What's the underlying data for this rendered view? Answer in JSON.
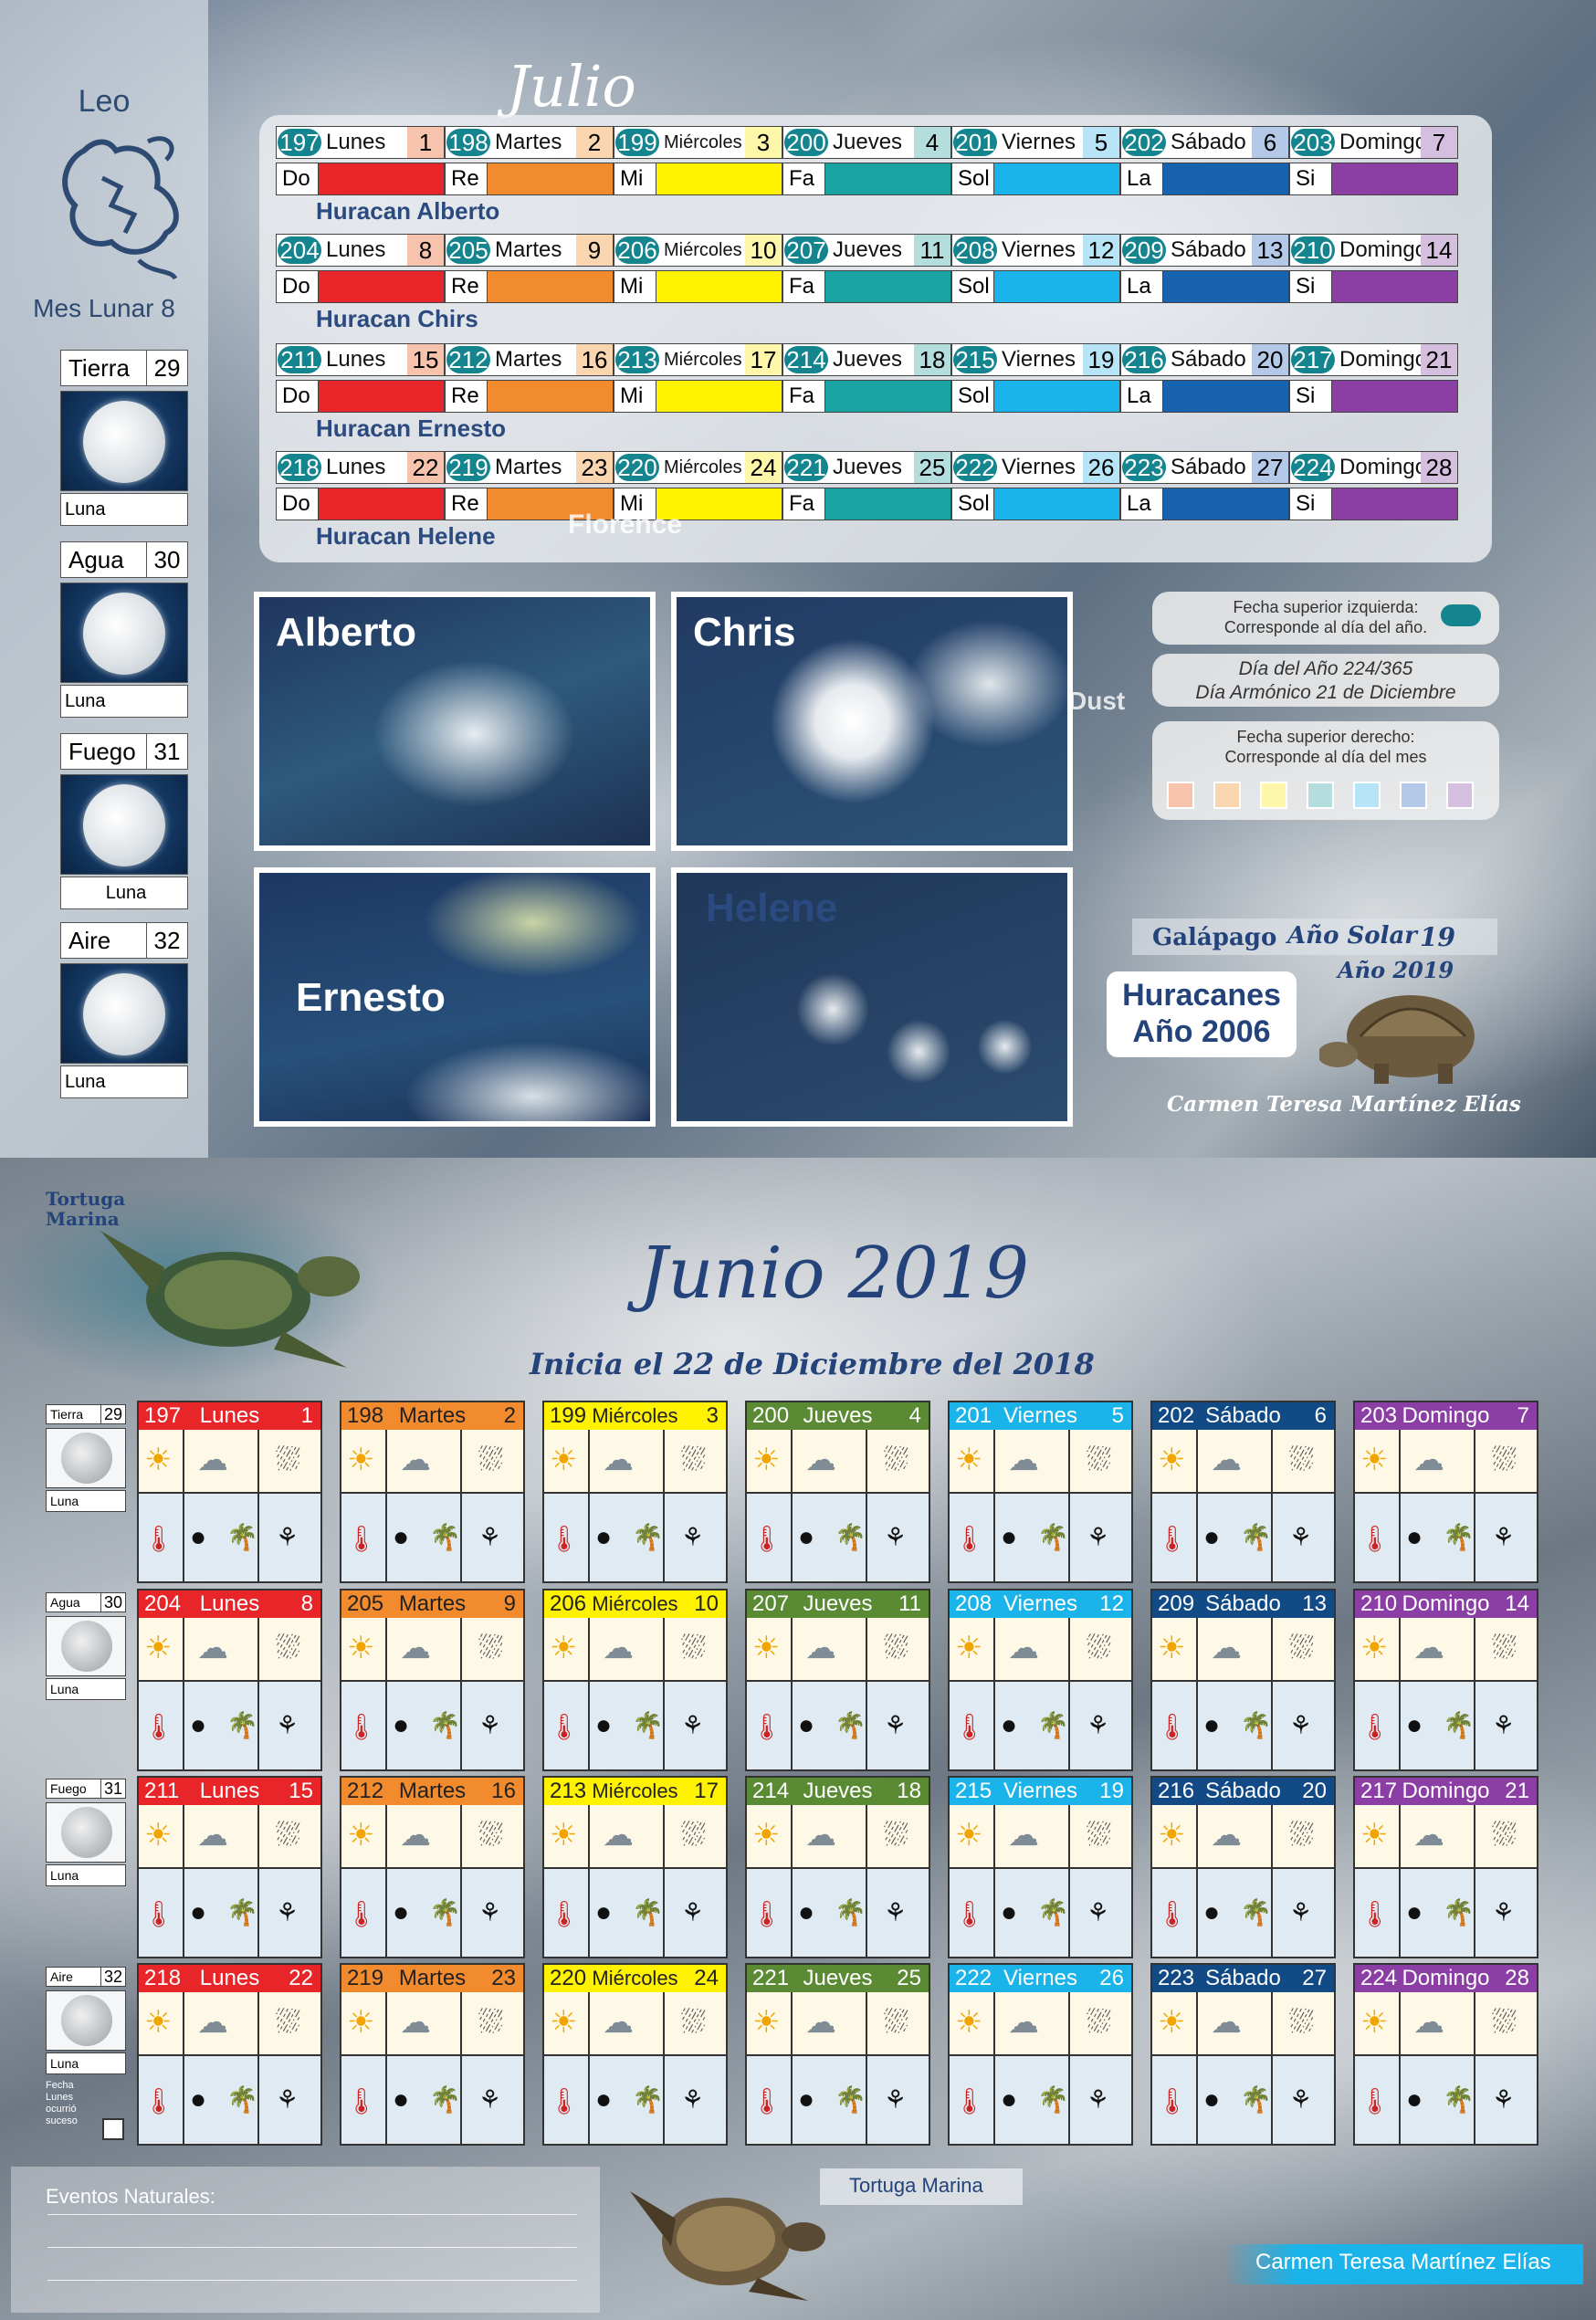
{
  "top": {
    "sign": "Leo",
    "lunar_month": "Mes Lunar 8",
    "elements": [
      {
        "name": "Tierra",
        "num": "29",
        "luna": "Luna"
      },
      {
        "name": "Agua",
        "num": "30",
        "luna": "Luna"
      },
      {
        "name": "Fuego",
        "num": "31",
        "luna": "Luna"
      },
      {
        "name": "Aire",
        "num": "32",
        "luna": "Luna"
      }
    ],
    "month_title": "Julio",
    "weeks": [
      {
        "days": [
          [
            "197",
            "Lunes",
            "1"
          ],
          [
            "198",
            "Martes",
            "2"
          ],
          [
            "199",
            "Miércoles",
            "3"
          ],
          [
            "200",
            "Jueves",
            "4"
          ],
          [
            "201",
            "Viernes",
            "5"
          ],
          [
            "202",
            "Sábado",
            "6"
          ],
          [
            "203",
            "Domingo",
            "7"
          ]
        ],
        "hurricane": "Huracan Alberto"
      },
      {
        "days": [
          [
            "204",
            "Lunes",
            "8"
          ],
          [
            "205",
            "Martes",
            "9"
          ],
          [
            "206",
            "Miércoles",
            "10"
          ],
          [
            "207",
            "Jueves",
            "11"
          ],
          [
            "208",
            "Viernes",
            "12"
          ],
          [
            "209",
            "Sábado",
            "13"
          ],
          [
            "210",
            "Domingo",
            "14"
          ]
        ],
        "hurricane": "Huracan Chirs"
      },
      {
        "days": [
          [
            "211",
            "Lunes",
            "15"
          ],
          [
            "212",
            "Martes",
            "16"
          ],
          [
            "213",
            "Miércoles",
            "17"
          ],
          [
            "214",
            "Jueves",
            "18"
          ],
          [
            "215",
            "Viernes",
            "19"
          ],
          [
            "216",
            "Sábado",
            "20"
          ],
          [
            "217",
            "Domingo",
            "21"
          ]
        ],
        "hurricane": "Huracan Ernesto"
      },
      {
        "days": [
          [
            "218",
            "Lunes",
            "22"
          ],
          [
            "219",
            "Martes",
            "23"
          ],
          [
            "220",
            "Miércoles",
            "24"
          ],
          [
            "221",
            "Jueves",
            "25"
          ],
          [
            "222",
            "Viernes",
            "26"
          ],
          [
            "223",
            "Sábado",
            "27"
          ],
          [
            "224",
            "Domingo",
            "28"
          ]
        ],
        "hurricane": "Huracan Helene"
      }
    ],
    "notes": [
      "Do",
      "Re",
      "Mi",
      "Fa",
      "Sol",
      "La",
      "Si"
    ],
    "note_colors": [
      "#e8262a",
      "#f28a2e",
      "#fff200",
      "#1aa3a3",
      "#1ab3ea",
      "#1763b0",
      "#8b3fa4"
    ],
    "daynum_colors": [
      "#f7c3ad",
      "#f9d6b0",
      "#fef6a8",
      "#b4dedd",
      "#b7e4f6",
      "#b3c9e7",
      "#d5bfde"
    ],
    "images": [
      "Alberto",
      "Chris",
      "Ernesto",
      "Helene"
    ],
    "info": {
      "left_top": "Fecha superior izquierda:",
      "left_top2": "Corresponde al día del año.",
      "day_of_year": "Día del Año 224/365",
      "harmonic_day": "Día Armónico 21 de Diciembre",
      "right_top": "Fecha superior derecho:",
      "right_top2": "Corresponde al día del mes"
    },
    "galapago": "Galápago",
    "solar_year_label": "Año Solar",
    "solar_year": "19",
    "year_label": "Año 20",
    "year_suffix": "19",
    "huracanes_1": "Huracanes",
    "huracanes_2": "Año 2006",
    "author": "Carmen Teresa Martínez Elías",
    "map_label_florence": "Florence",
    "map_label_dust": "Dust"
  },
  "bottom": {
    "turtle_label_1": "Tortuga",
    "turtle_label_2": "Marina",
    "month_title": "Junio 2019",
    "subtitle": "Inicia el 22 de Diciembre del 2018",
    "header_colors": [
      "#e8262a",
      "#f28a2e",
      "#fff200",
      "#5a8a33",
      "#1ab3ea",
      "#124a85",
      "#8b3fa4"
    ],
    "header_text_colors": [
      "#ffffff",
      "#222222",
      "#222222",
      "#ffffff",
      "#ffffff",
      "#ffffff",
      "#ffffff"
    ],
    "elements": [
      {
        "name": "Tierra",
        "num": "29",
        "luna": "Luna"
      },
      {
        "name": "Agua",
        "num": "30",
        "luna": "Luna"
      },
      {
        "name": "Fuego",
        "num": "31",
        "luna": "Luna"
      },
      {
        "name": "Aire",
        "num": "32",
        "luna": "Luna"
      }
    ],
    "weeks": [
      [
        [
          "197",
          "Lunes",
          "1"
        ],
        [
          "198",
          "Martes",
          "2"
        ],
        [
          "199",
          "Miércoles",
          "3"
        ],
        [
          "200",
          "Jueves",
          "4"
        ],
        [
          "201",
          "Viernes",
          "5"
        ],
        [
          "202",
          "Sábado",
          "6"
        ],
        [
          "203",
          "Domingo",
          "7"
        ]
      ],
      [
        [
          "204",
          "Lunes",
          "8"
        ],
        [
          "205",
          "Martes",
          "9"
        ],
        [
          "206",
          "Miércoles",
          "10"
        ],
        [
          "207",
          "Jueves",
          "11"
        ],
        [
          "208",
          "Viernes",
          "12"
        ],
        [
          "209",
          "Sábado",
          "13"
        ],
        [
          "210",
          "Domingo",
          "14"
        ]
      ],
      [
        [
          "211",
          "Lunes",
          "15"
        ],
        [
          "212",
          "Martes",
          "16"
        ],
        [
          "213",
          "Miércoles",
          "17"
        ],
        [
          "214",
          "Jueves",
          "18"
        ],
        [
          "215",
          "Viernes",
          "19"
        ],
        [
          "216",
          "Sábado",
          "20"
        ],
        [
          "217",
          "Domingo",
          "21"
        ]
      ],
      [
        [
          "218",
          "Lunes",
          "22"
        ],
        [
          "219",
          "Martes",
          "23"
        ],
        [
          "220",
          "Miércoles",
          "24"
        ],
        [
          "221",
          "Jueves",
          "25"
        ],
        [
          "222",
          "Viernes",
          "26"
        ],
        [
          "223",
          "Sábado",
          "27"
        ],
        [
          "224",
          "Domingo",
          "28"
        ]
      ]
    ],
    "events_label": "Eventos Naturales:",
    "tortuga_marina": "Tortuga Marina",
    "author": "Carmen Teresa Martínez Elías",
    "small_note": "Fecha Lunes ocurrió suceso"
  }
}
